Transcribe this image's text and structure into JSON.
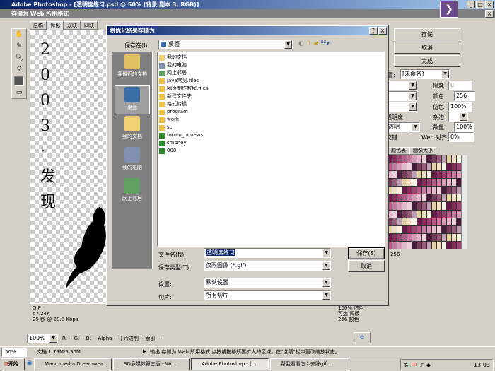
{
  "app": {
    "title": "Adobe Photoshop - [透明度练习.psd @ 50% (背景 副本 3, RGB)]"
  },
  "sfw": {
    "title": "存储为 Web 所用格式",
    "tabs": [
      "原稿",
      "优化",
      "双联",
      "四联"
    ],
    "buttons": {
      "save": "存储",
      "cancel": "取消",
      "done": "完成"
    },
    "settings": {
      "label": "设置:",
      "value": "[未命名]",
      "lossy_label": "损耗:",
      "lossy_value": "0",
      "colors_label": "颜色:",
      "colors_value": "256",
      "dither_label": "仿色:",
      "dither_value": "100%",
      "matte_label": "杂边:",
      "transparency_label": "透明度",
      "transparency_value": "透明",
      "amount_label": "数量:",
      "amount_value": "100%",
      "interlaced_label": "交错",
      "web_snap_label": "Web 对齐:",
      "web_snap_value": "0%"
    },
    "color_tabs": [
      "颜色表",
      "图像大小"
    ],
    "color_count": "256",
    "info": {
      "format": "GIF",
      "size": "67.24K",
      "time": "25 秒 @ 28.8 Kbps",
      "dither_pct": "100% 仿色",
      "palette": "可选 调板",
      "colors": "256 颜色"
    },
    "zoom": "100%",
    "readout": "R: -- G: -- B: -- Alpha -- 十六进制 -- 索引: --",
    "artwork_text": "2003·发现"
  },
  "dialog": {
    "title": "将优化结果存储为",
    "save_in_label": "保存在(I):",
    "save_in_value": "桌面",
    "places": [
      {
        "name": "我最近的文档",
        "color": "#e0c060"
      },
      {
        "name": "桌面",
        "color": "#3a6ea5"
      },
      {
        "name": "我的文档",
        "color": "#f0d070"
      },
      {
        "name": "我的电脑",
        "color": "#8090b0"
      },
      {
        "name": "网上邻居",
        "color": "#60a060"
      }
    ],
    "files": [
      {
        "name": "我的文档",
        "icon": "#f0d070"
      },
      {
        "name": "我的电脑",
        "icon": "#8090b0"
      },
      {
        "name": "网上邻居",
        "icon": "#60a060"
      },
      {
        "name": "java常见.files",
        "icon": "#f0c040"
      },
      {
        "name": "网页制作教程.files",
        "icon": "#f0c040"
      },
      {
        "name": "新建文件夹",
        "icon": "#f0c040"
      },
      {
        "name": "格式转换",
        "icon": "#f0c040"
      },
      {
        "name": "program",
        "icon": "#f0c040"
      },
      {
        "name": "work",
        "icon": "#f0c040"
      },
      {
        "name": "sc",
        "icon": "#f0c040"
      },
      {
        "name": "forum_nonews",
        "icon": "#2a8a2a"
      },
      {
        "name": "smoney",
        "icon": "#2a8a2a"
      },
      {
        "name": "000",
        "icon": "#2a8a2a"
      }
    ],
    "filename_label": "文件名(N):",
    "filename_value": "透明度练习",
    "filetype_label": "保存类型(T):",
    "filetype_value": "仅限图像 (*.gif)",
    "settings_label": "设置:",
    "settings_value": "默认设置",
    "slices_label": "切片:",
    "slices_value": "所有切片",
    "save_button": "保存(S)",
    "cancel_button": "取消"
  },
  "status": {
    "zoom": "50%",
    "doc": "文档:1.79M/5.96M",
    "hint": "输出:存储为 Web 所用格式 点按或拖移所要扩大的区域。在\"选项\"栏中更改缩放状态。"
  },
  "taskbar": {
    "start": "开始",
    "items": [
      "Macromedia Dreamwea...",
      "SD多媒体第三版 - Wi...",
      "Adobe Photoshop - [...",
      "帮我看看怎么去除gif..."
    ],
    "clock": "13:03",
    "ime": "中"
  }
}
